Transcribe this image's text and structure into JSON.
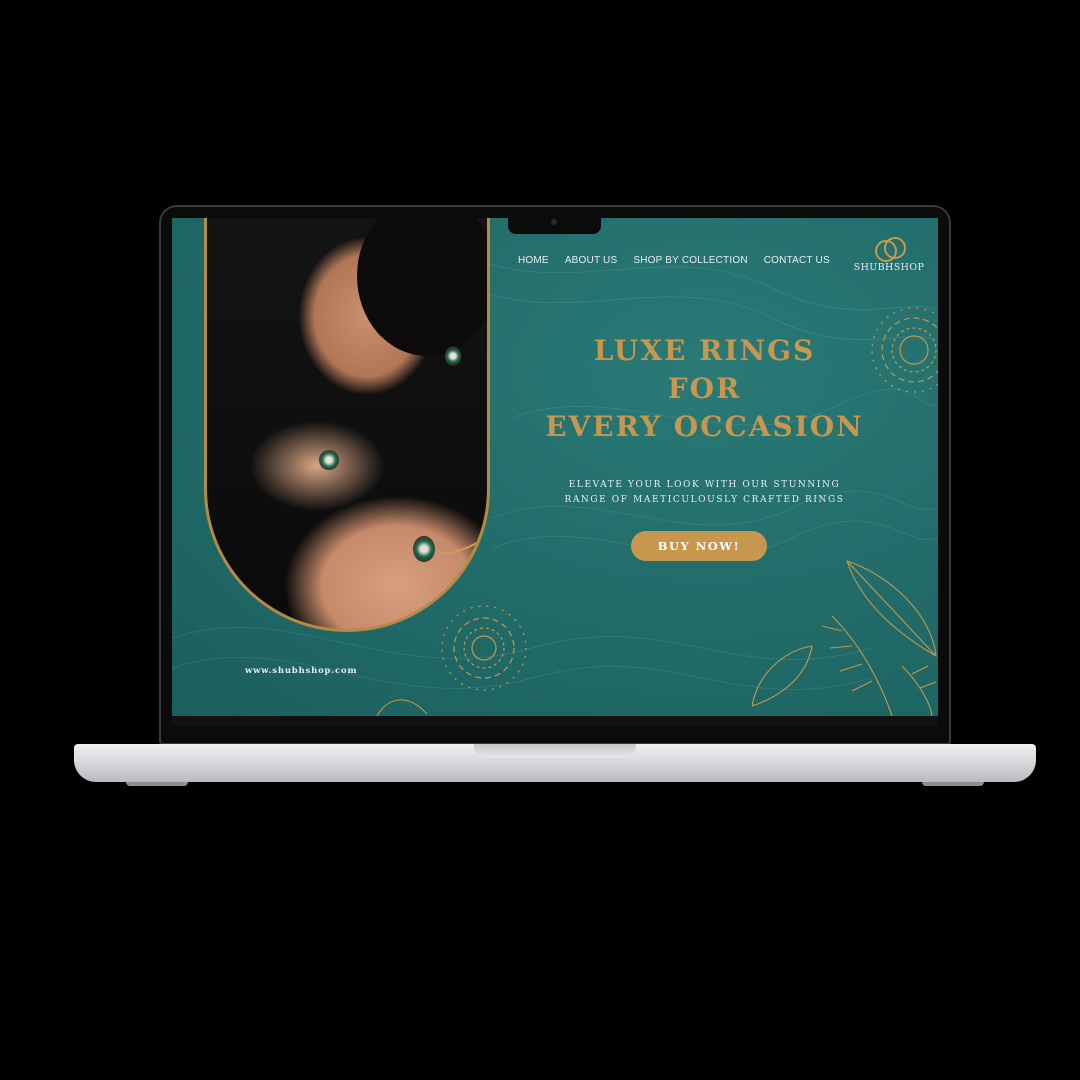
{
  "nav": {
    "items": [
      {
        "label": "HOME"
      },
      {
        "label": "ABOUT US"
      },
      {
        "label": "SHOP BY COLLECTION"
      },
      {
        "label": "CONTACT US"
      }
    ]
  },
  "logo": {
    "text": "SHUBHSHOP",
    "icon": "interlocked-rings-icon"
  },
  "hero": {
    "title_line1": "LUXE RINGS",
    "title_line2": "FOR",
    "title_line3": "EVERY OCCASION",
    "subtitle_line1": "ELEVATE YOUR LOOK WITH OUR STUNNING",
    "subtitle_line2": "RANGE OF MAETICULOUSLY CRAFTED RINGS",
    "cta_label": "BUY NOW!"
  },
  "footer": {
    "url": "www.shubhshop.com"
  },
  "colors": {
    "accent": "#c7974d",
    "background": "#226d6b",
    "text": "#e8eef0"
  }
}
